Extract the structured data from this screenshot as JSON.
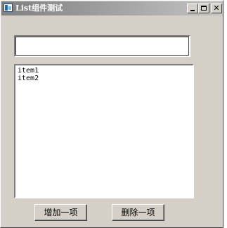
{
  "window": {
    "title": "List组件测试",
    "icon": "app-window-icon",
    "controls": {
      "minimize": "minimize-icon",
      "maximize": "maximize-icon",
      "close": "✕"
    }
  },
  "input": {
    "value": "",
    "placeholder": ""
  },
  "list": {
    "items": [
      "item1",
      "item2"
    ]
  },
  "buttons": {
    "add_label": "增加一项",
    "delete_label": "删除一项"
  }
}
